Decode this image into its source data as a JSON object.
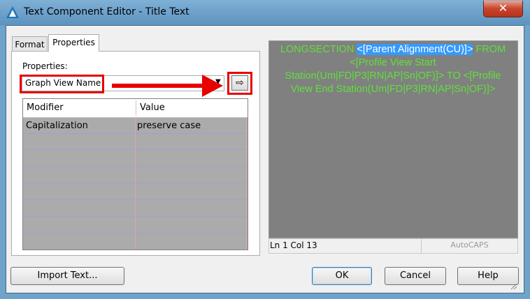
{
  "window": {
    "title": "Text Component Editor - Title Text",
    "close_label": "✕"
  },
  "tabs": [
    {
      "label": "Format"
    },
    {
      "label": "Properties"
    }
  ],
  "properties": {
    "label": "Properties:",
    "selected": "Graph View Name",
    "dropdown_arrow": "▼",
    "add_button_glyph": "⇨"
  },
  "grid": {
    "columns": [
      "Modifier",
      "Value"
    ],
    "rows": [
      {
        "modifier": "Capitalization",
        "value": "preserve case"
      }
    ]
  },
  "editor": {
    "text_before": "LONGSECTION ",
    "selected_text": "<[Parent Alignment(CU)]>",
    "text_after": " FROM <[Profile View Start Station(Um|FD|P3|RN|AP|Sn|OF)]> TO <[Profile View End Station(Um|FD|P3|RN|AP|Sn|OF)]>",
    "text_color": "#5fe03a"
  },
  "status": {
    "position": "Ln 1 Col 13",
    "mode": "AutoCAPS"
  },
  "buttons": {
    "import": "Import Text...",
    "ok": "OK",
    "cancel": "Cancel",
    "help": "Help"
  },
  "colors": {
    "annotation_red": "#e60000",
    "selection_blue": "#3399ff"
  }
}
